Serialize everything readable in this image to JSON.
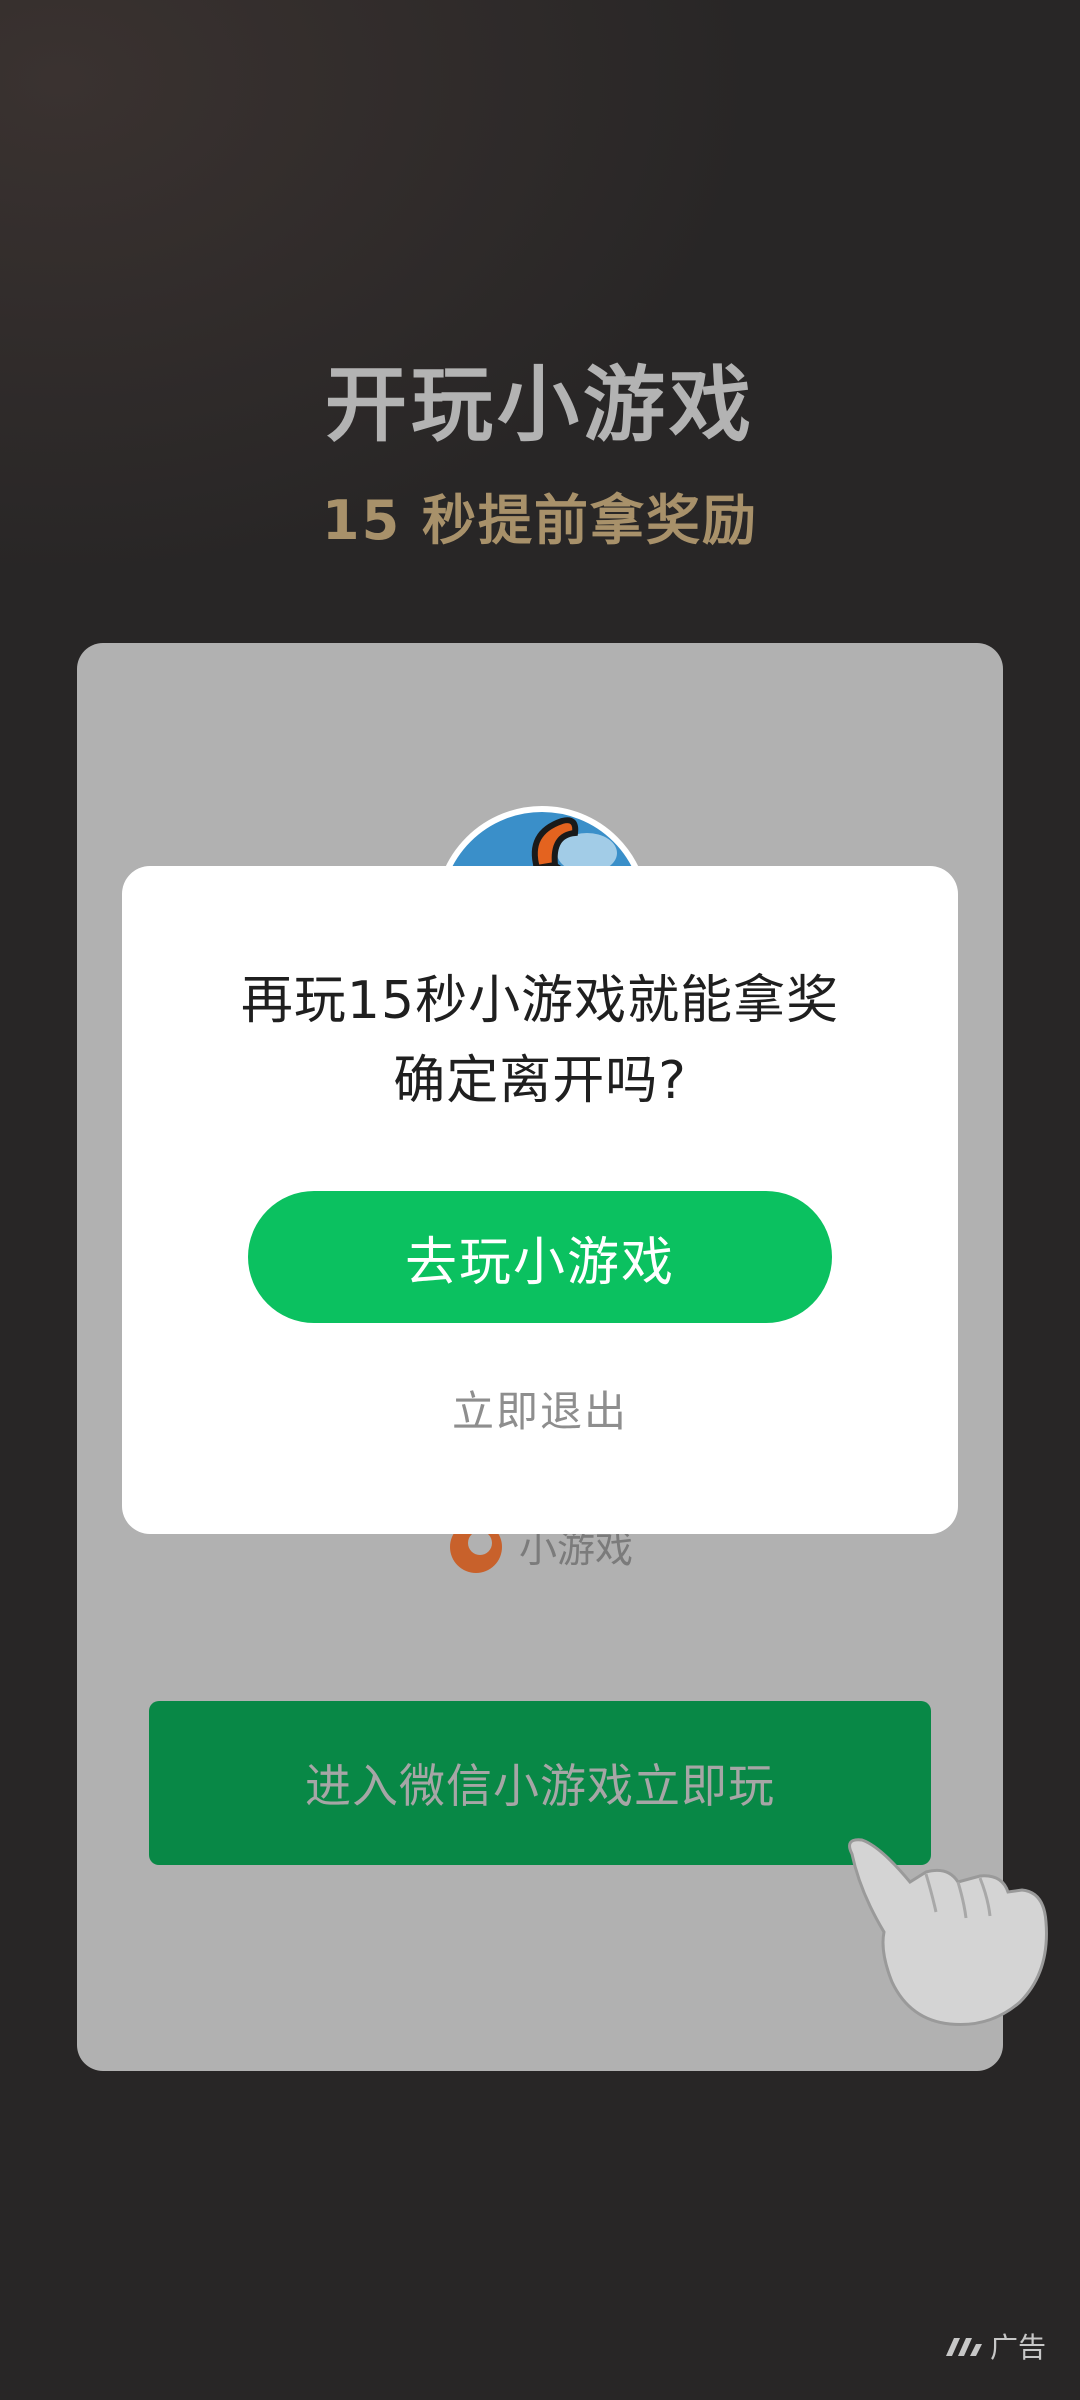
{
  "header": {
    "title": "开玩小游戏",
    "subtitle": "15 秒提前拿奖励"
  },
  "card": {
    "brand_label": "小游戏",
    "enter_button_label": "进入微信小游戏立即玩"
  },
  "dialog": {
    "line1": "再玩15秒小游戏就能拿奖",
    "line2": "确定离开吗?",
    "play_button_label": "去玩小游戏",
    "exit_label": "立即退出"
  },
  "ad": {
    "label": "广告",
    "icon": "ad-logo-icon"
  },
  "colors": {
    "accent_green": "#0bc160",
    "enter_green": "#088846",
    "gold": "#a8916a"
  }
}
